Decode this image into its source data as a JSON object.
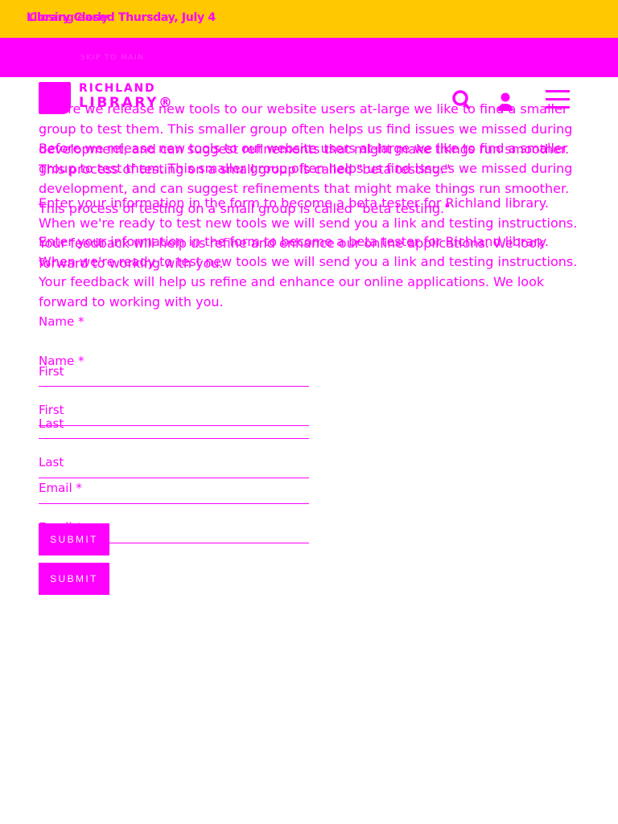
{
  "alert": {
    "text_a": "Library Closed Thursday, July 4",
    "text_b": "Closing early"
  },
  "nav": {
    "skip_link": "SKIP TO MAIN"
  },
  "logo": {
    "line1": "RICHLAND",
    "line2": "LIBRARY®"
  },
  "header_icons": {
    "search": "search-icon",
    "account": "user-icon",
    "menu": "menu-icon"
  },
  "page": {
    "intro_1": "Before we release new tools to our website users at-large we like to find a smaller group to test them. This smaller group often helps us find issues we missed during development, and can suggest refinements that might make things run smoother. This process of testing on a small group is called \"beta testing.\"",
    "intro_2": "Enter your information in the form to become a beta tester for Richland library. When we're ready to test new tools we will send you a link and testing instructions. Your feedback will help us refine and enhance our online applications. We look forward to working with you."
  },
  "form": {
    "name_label": "Name *",
    "first_label": "First",
    "last_label": "Last",
    "email_label": "Email *",
    "submit_label": "SUBMIT"
  },
  "colors": {
    "alert_bg": "#ffc800",
    "accent": "#ff00ff",
    "background": "#ffffff"
  }
}
